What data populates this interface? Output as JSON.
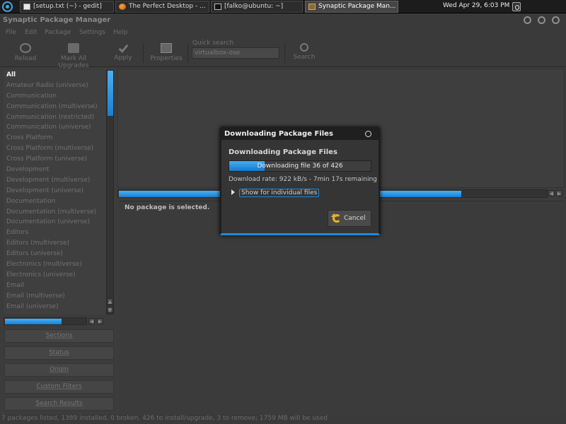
{
  "panel": {
    "tasks": [
      {
        "label": "[setup.txt (~) - gedit]",
        "icon": "document-icon"
      },
      {
        "label": "The Perfect Desktop - ...",
        "icon": "firefox-icon"
      },
      {
        "label": "[falko@ubuntu: ~]",
        "icon": "terminal-icon"
      },
      {
        "label": "Synaptic Package Man...",
        "icon": "package-icon"
      }
    ],
    "clock": "Wed Apr 29,  6:03 PM"
  },
  "window": {
    "title": "Synaptic Package Manager",
    "menu": [
      "File",
      "Edit",
      "Package",
      "Settings",
      "Help"
    ]
  },
  "toolbar": {
    "reload": "Reload",
    "mark_all": "Mark All Upgrades",
    "apply": "Apply",
    "properties": "Properties",
    "quick_search_label": "Quick search",
    "quick_search_value": "virtualbox-ose",
    "search": "Search"
  },
  "sections": [
    "All",
    "Amateur Radio (universe)",
    "Communication",
    "Communication (multiverse)",
    "Communication (restricted)",
    "Communication (universe)",
    "Cross Platform",
    "Cross Platform (multiverse)",
    "Cross Platform (universe)",
    "Development",
    "Development (multiverse)",
    "Development (universe)",
    "Documentation",
    "Documentation (multiverse)",
    "Documentation (universe)",
    "Editors",
    "Editors (multiverse)",
    "Editors (universe)",
    "Electronics (multiverse)",
    "Electronics (universe)",
    "Email",
    "Email (multiverse)",
    "Email (universe)"
  ],
  "filter_buttons": [
    "Sections",
    "Status",
    "Origin",
    "Custom Filters",
    "Search Results"
  ],
  "details": {
    "message": "No package is selected."
  },
  "statusbar": "7 packages listed, 1389 installed, 0 broken. 426 to install/upgrade, 3 to remove; 1759 MB will be used",
  "dialog": {
    "title": "Downloading Package Files",
    "heading": "Downloading Package Files",
    "progress_text": "Downloading file 36 of 426",
    "progress_fraction": 0.25,
    "rate": "Download rate: 922 kB/s - 7min 17s remaining",
    "expander": "Show for individual files",
    "cancel": "Cancel"
  },
  "colors": {
    "accent": "#1d8be0",
    "background": "#3c3c3c",
    "cancel_icon": "#e8b422"
  }
}
